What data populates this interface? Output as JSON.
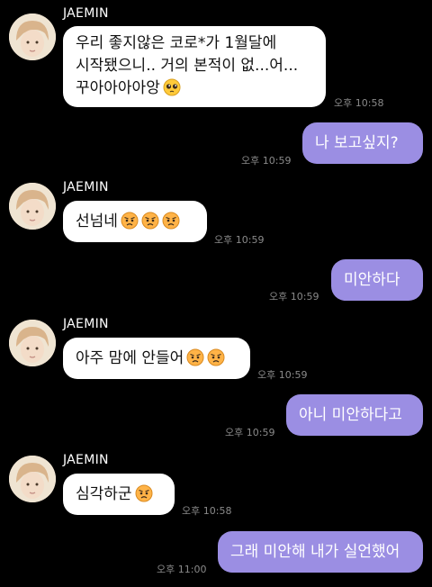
{
  "sender_name": "JAEMIN",
  "messages": [
    {
      "line1": "우리 좋지않은 코로*가 1월달에",
      "line2": "시작됐으니.. 거의 본적이 없...어...",
      "line3": "꾸아아아아앙",
      "emoji": "pleading-face",
      "time": "오후 10:58"
    },
    {
      "text": "나 보고싶지?",
      "time": "오후 10:59"
    },
    {
      "text": "선넘네",
      "emoji": "angry-face x3",
      "time": "오후 10:59"
    },
    {
      "text": "미안하다",
      "time": "오후 10:59"
    },
    {
      "text": "아주 맘에 안들어",
      "emoji": "angry-face x2",
      "time": "오후 10:59"
    },
    {
      "text": "아니 미안하다고",
      "time": "오후 10:59"
    },
    {
      "text": "심각하군",
      "emoji": "angry-face",
      "time": "오후 10:58"
    },
    {
      "text": "그래 미안해 내가 실언했어",
      "time": "오후 11:00"
    }
  ],
  "colors": {
    "background": "#000000",
    "incoming_bubble": "#ffffff",
    "outgoing_bubble": "#9b8ee3",
    "timestamp": "#8a8a8a"
  }
}
